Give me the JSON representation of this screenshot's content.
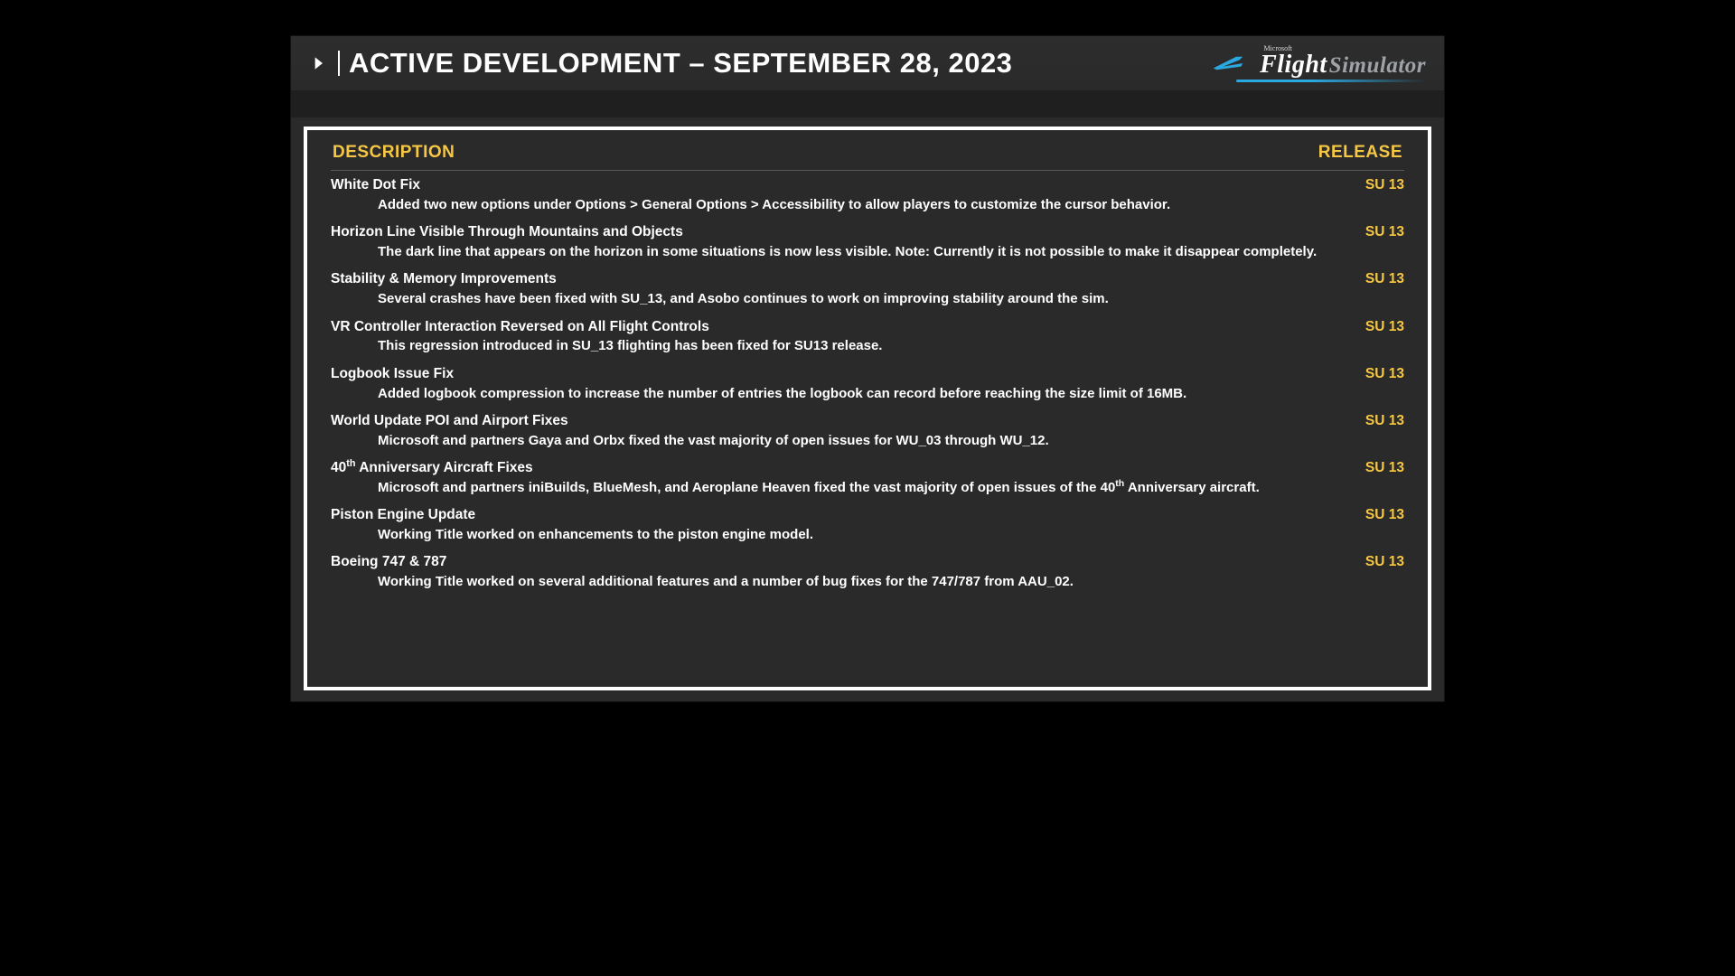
{
  "header": {
    "title": "ACTIVE DEVELOPMENT – SEPTEMBER 28, 2023",
    "logo": {
      "brand_small": "Microsoft",
      "word1": "Flight",
      "word2": "Simulator"
    }
  },
  "columns": {
    "description": "DESCRIPTION",
    "release": "RELEASE"
  },
  "items": [
    {
      "title": "White Dot Fix",
      "desc": "Added two new options under Options > General Options > Accessibility to allow players to customize the cursor behavior.",
      "release": "SU 13"
    },
    {
      "title": "Horizon Line Visible Through Mountains and Objects",
      "desc": "The dark line that appears on the horizon in some situations is now less visible. Note: Currently it is not possible to make it disappear completely.",
      "release": "SU 13"
    },
    {
      "title": "Stability & Memory Improvements",
      "desc": "Several crashes have been fixed with SU_13, and Asobo continues to work on improving stability around the sim.",
      "release": "SU 13"
    },
    {
      "title": "VR Controller Interaction Reversed on All Flight Controls",
      "desc": "This regression introduced in SU_13 flighting has been fixed for SU13 release.",
      "release": "SU 13"
    },
    {
      "title": "Logbook Issue Fix",
      "desc": "Added logbook compression to increase the number of entries the logbook can record before reaching the size limit of 16MB.",
      "release": "SU 13"
    },
    {
      "title": "World Update POI and Airport Fixes",
      "desc": "Microsoft and partners Gaya and Orbx fixed the vast majority of open issues for WU_03 through WU_12.",
      "release": "SU 13"
    },
    {
      "title_html": "40<sup>th</sup> Anniversary Aircraft Fixes",
      "desc_html": "Microsoft and partners iniBuilds, BlueMesh, and Aeroplane Heaven fixed the vast majority of open issues of the 40<sup>th</sup> Anniversary aircraft.",
      "release": "SU 13"
    },
    {
      "title": "Piston Engine Update",
      "desc": "Working Title worked on enhancements to the piston engine model.",
      "release": "SU 13"
    },
    {
      "title": "Boeing 747 & 787",
      "desc": "Working Title worked on several additional features and a number of bug fixes for the 747/787 from AAU_02.",
      "release": "SU 13"
    }
  ]
}
